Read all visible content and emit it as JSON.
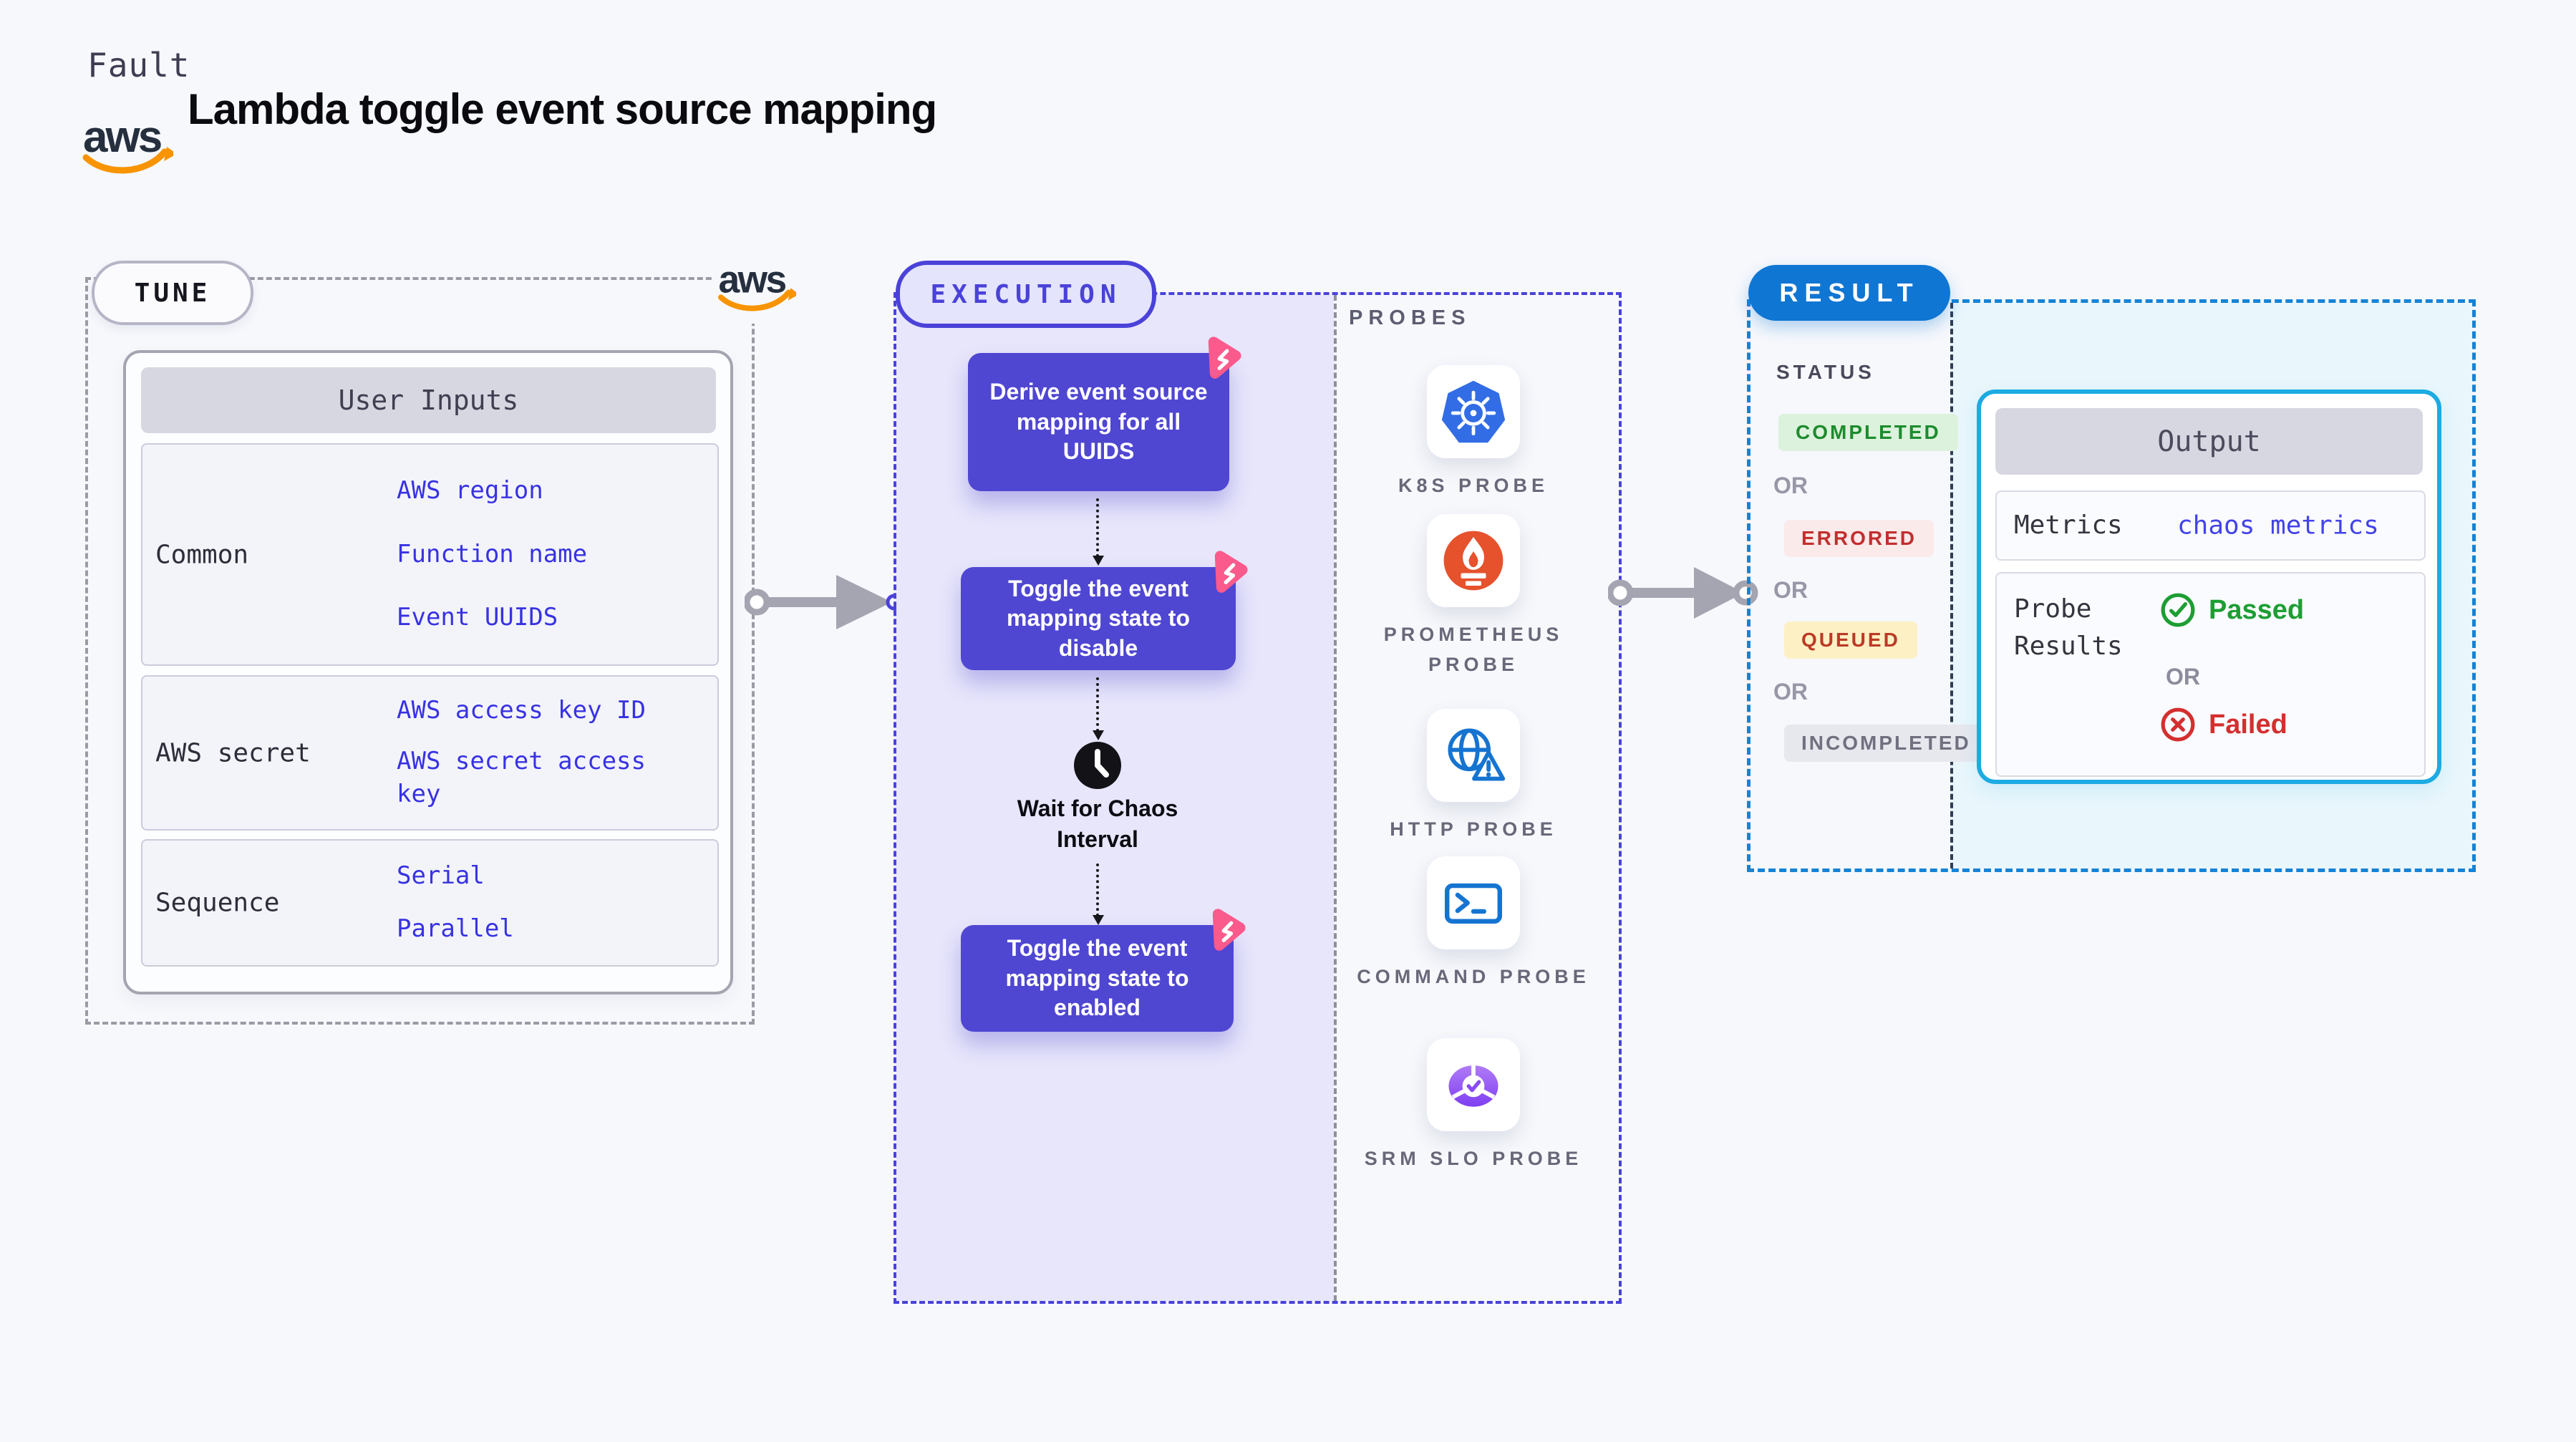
{
  "header": {
    "fault_label": "Fault",
    "title": "Lambda toggle event source mapping",
    "aws_logo_text": "aws"
  },
  "tune": {
    "badge": "TUNE",
    "aws_logo_text": "aws",
    "table": {
      "header": "User Inputs",
      "rows": [
        {
          "label": "Common",
          "links": [
            "AWS region",
            "Function name",
            "Event UUIDS"
          ]
        },
        {
          "label": "AWS secret",
          "links": [
            "AWS access key ID",
            "AWS secret access key"
          ]
        },
        {
          "label": "Sequence",
          "links": [
            "Serial",
            "Parallel"
          ]
        }
      ]
    }
  },
  "execution": {
    "badge": "EXECUTION",
    "steps": [
      {
        "text": "Derive event source mapping for all UUIDS"
      },
      {
        "text": "Toggle the event mapping state to disable"
      },
      {
        "text": "Toggle the event mapping state to enabled"
      }
    ],
    "wait_label": "Wait for Chaos Interval"
  },
  "probes": {
    "heading": "PROBES",
    "items": [
      {
        "icon": "k8s-icon",
        "label": "K8S PROBE"
      },
      {
        "icon": "prometheus-icon",
        "label": "PROMETHEUS PROBE"
      },
      {
        "icon": "http-icon",
        "label": "HTTP PROBE"
      },
      {
        "icon": "command-icon",
        "label": "COMMAND PROBE"
      },
      {
        "icon": "srm-slo-icon",
        "label": "SRM SLO PROBE"
      }
    ]
  },
  "result": {
    "badge": "RESULT",
    "status_heading": "STATUS",
    "or_label": "OR",
    "statuses": [
      {
        "label": "COMPLETED",
        "fg": "#1c8c2e",
        "bg": "#dcf2dc"
      },
      {
        "label": "ERRORED",
        "fg": "#c22f2f",
        "bg": "#fbeaea"
      },
      {
        "label": "QUEUED",
        "fg": "#bb3a25",
        "bg": "#fdf0c5"
      },
      {
        "label": "INCOMPLETED",
        "fg": "#70707f",
        "bg": "#e7e7ee"
      }
    ],
    "output": {
      "header": "Output",
      "metrics_label": "Metrics",
      "metrics_link": "chaos metrics",
      "probe_results_label": "Probe Results",
      "passed_label": "Passed",
      "or_label": "OR",
      "failed_label": "Failed"
    }
  },
  "colors": {
    "page_bg": "#f6f8fc",
    "accent_purple": "#4a42d8",
    "execution_fill": "#e7e6fb",
    "step_box": "#4f46d2",
    "chaos_pink": "#fa5a8c",
    "accent_blue": "#1076d3",
    "result_fill": "#e9f6fc",
    "output_border": "#1cabe2",
    "link_blue": "#3832e2",
    "passed_green": "#1d9e33",
    "failed_red": "#d42f2f",
    "aws_orange": "#f79400",
    "k8s_blue": "#326de6",
    "prometheus_orange": "#e6522c",
    "http_blue": "#1674d1",
    "srm_purple": "#8a4bf4"
  }
}
